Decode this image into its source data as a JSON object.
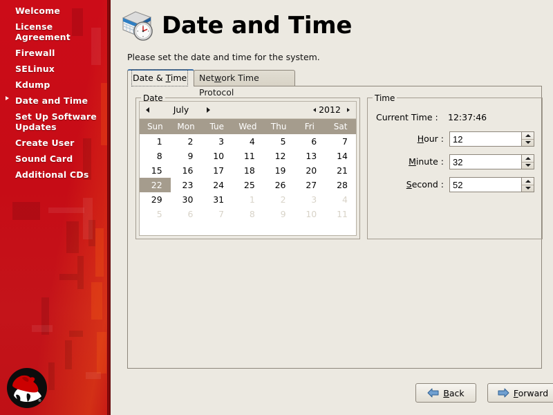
{
  "sidebar": {
    "items": [
      {
        "label": "Welcome",
        "active": false
      },
      {
        "label": "License Agreement",
        "active": false
      },
      {
        "label": "Firewall",
        "active": false
      },
      {
        "label": "SELinux",
        "active": false
      },
      {
        "label": "Kdump",
        "active": false
      },
      {
        "label": "Date and Time",
        "active": true
      },
      {
        "label": "Set Up Software Updates",
        "active": false
      },
      {
        "label": "Create User",
        "active": false
      },
      {
        "label": "Sound Card",
        "active": false
      },
      {
        "label": "Additional CDs",
        "active": false
      }
    ],
    "logo_name": "redhat-shadowman-logo",
    "background_color": "#c80d18"
  },
  "header": {
    "icon_name": "calendar-clock-icon",
    "title": "Date and Time",
    "subtitle": "Please set the date and time for the system."
  },
  "tabs": [
    {
      "label_before": "Date & ",
      "accel": "T",
      "label_after": "ime",
      "active": true
    },
    {
      "label_before": "Net",
      "accel": "w",
      "label_after": "ork Time Protocol",
      "active": false
    }
  ],
  "date_group": {
    "label_accel": "D",
    "label_rest": "ate",
    "month": "July",
    "year": "2012",
    "prev_month_icon": "left-arrow-icon",
    "next_month_icon": "right-arrow-icon",
    "prev_year_icon": "left-arrow-icon",
    "next_year_icon": "right-arrow-icon",
    "weekdays": [
      "Sun",
      "Mon",
      "Tue",
      "Wed",
      "Thu",
      "Fri",
      "Sat"
    ],
    "selected_day": 22,
    "weeks": [
      [
        {
          "d": "1",
          "dim": false
        },
        {
          "d": "2",
          "dim": false
        },
        {
          "d": "3",
          "dim": false
        },
        {
          "d": "4",
          "dim": false
        },
        {
          "d": "5",
          "dim": false
        },
        {
          "d": "6",
          "dim": false
        },
        {
          "d": "7",
          "dim": false
        }
      ],
      [
        {
          "d": "8",
          "dim": false
        },
        {
          "d": "9",
          "dim": false
        },
        {
          "d": "10",
          "dim": false
        },
        {
          "d": "11",
          "dim": false
        },
        {
          "d": "12",
          "dim": false
        },
        {
          "d": "13",
          "dim": false
        },
        {
          "d": "14",
          "dim": false
        }
      ],
      [
        {
          "d": "15",
          "dim": false
        },
        {
          "d": "16",
          "dim": false
        },
        {
          "d": "17",
          "dim": false
        },
        {
          "d": "18",
          "dim": false
        },
        {
          "d": "19",
          "dim": false
        },
        {
          "d": "20",
          "dim": false
        },
        {
          "d": "21",
          "dim": false
        }
      ],
      [
        {
          "d": "22",
          "dim": false,
          "sel": true
        },
        {
          "d": "23",
          "dim": false
        },
        {
          "d": "24",
          "dim": false
        },
        {
          "d": "25",
          "dim": false
        },
        {
          "d": "26",
          "dim": false
        },
        {
          "d": "27",
          "dim": false
        },
        {
          "d": "28",
          "dim": false
        }
      ],
      [
        {
          "d": "29",
          "dim": false
        },
        {
          "d": "30",
          "dim": false
        },
        {
          "d": "31",
          "dim": false
        },
        {
          "d": "1",
          "dim": true
        },
        {
          "d": "2",
          "dim": true
        },
        {
          "d": "3",
          "dim": true
        },
        {
          "d": "4",
          "dim": true
        }
      ],
      [
        {
          "d": "5",
          "dim": true
        },
        {
          "d": "6",
          "dim": true
        },
        {
          "d": "7",
          "dim": true
        },
        {
          "d": "8",
          "dim": true
        },
        {
          "d": "9",
          "dim": true
        },
        {
          "d": "10",
          "dim": true
        },
        {
          "d": "11",
          "dim": true
        }
      ]
    ]
  },
  "time_group": {
    "label": "Time",
    "current_time_label": "Current Time :",
    "current_time_value": "12:37:46",
    "fields": [
      {
        "label_accel": "H",
        "label_rest": "our :",
        "value": "12"
      },
      {
        "label_accel": "M",
        "label_rest": "inute :",
        "value": "32"
      },
      {
        "label_accel": "S",
        "label_rest": "econd :",
        "value": "52"
      }
    ],
    "spinner_up_icon": "triangle-up-icon",
    "spinner_down_icon": "triangle-down-icon"
  },
  "footer": {
    "back": {
      "accel": "B",
      "rest": "ack",
      "icon": "arrow-left-icon"
    },
    "forward": {
      "accel": "F",
      "rest": "orward",
      "icon": "arrow-right-icon"
    }
  }
}
